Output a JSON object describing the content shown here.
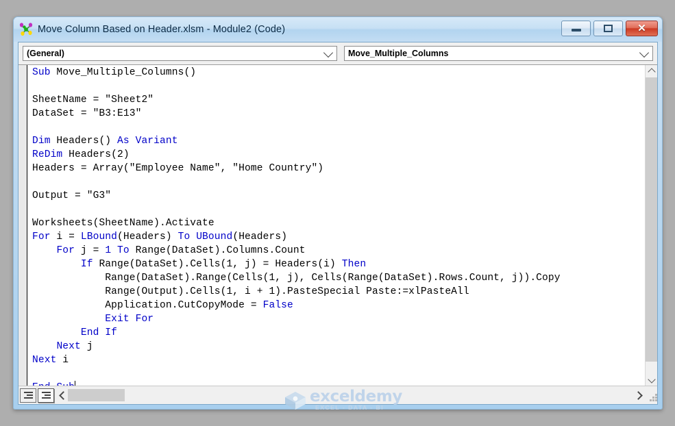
{
  "window": {
    "title": "Move Column Based on Header.xlsm - Module2 (Code)",
    "icon": "vba-module-icon",
    "buttons": {
      "minimize": "minimize-icon",
      "maximize": "maximize-icon",
      "close": "✕"
    }
  },
  "toolbar": {
    "object_combo": {
      "value": "(General)",
      "arrow": "chevron-down-icon"
    },
    "procedure_combo": {
      "value": "Move_Multiple_Columns",
      "arrow": "chevron-down-icon"
    }
  },
  "code": {
    "lines": [
      [
        {
          "t": "Sub",
          "k": true
        },
        {
          "t": " Move_Multiple_Columns()",
          "k": false
        }
      ],
      [],
      [
        {
          "t": "SheetName = \"Sheet2\"",
          "k": false
        }
      ],
      [
        {
          "t": "DataSet = \"B3:E13\"",
          "k": false
        }
      ],
      [],
      [
        {
          "t": "Dim",
          "k": true
        },
        {
          "t": " Headers() ",
          "k": false
        },
        {
          "t": "As Variant",
          "k": true
        }
      ],
      [
        {
          "t": "ReDim",
          "k": true
        },
        {
          "t": " Headers(2)",
          "k": false
        }
      ],
      [
        {
          "t": "Headers = Array(\"Employee Name\", \"Home Country\")",
          "k": false
        }
      ],
      [],
      [
        {
          "t": "Output = \"G3\"",
          "k": false
        }
      ],
      [],
      [
        {
          "t": "Worksheets(SheetName).Activate",
          "k": false
        }
      ],
      [
        {
          "t": "For",
          "k": true
        },
        {
          "t": " i = ",
          "k": false
        },
        {
          "t": "LBound",
          "k": true
        },
        {
          "t": "(Headers) ",
          "k": false
        },
        {
          "t": "To",
          "k": true
        },
        {
          "t": " ",
          "k": false
        },
        {
          "t": "UBound",
          "k": true
        },
        {
          "t": "(Headers)",
          "k": false
        }
      ],
      [
        {
          "t": "    ",
          "k": false
        },
        {
          "t": "For",
          "k": true
        },
        {
          "t": " j = ",
          "k": false
        },
        {
          "t": "1",
          "k": true
        },
        {
          "t": " ",
          "k": false
        },
        {
          "t": "To",
          "k": true
        },
        {
          "t": " Range(DataSet).Columns.Count",
          "k": false
        }
      ],
      [
        {
          "t": "        ",
          "k": false
        },
        {
          "t": "If",
          "k": true
        },
        {
          "t": " Range(DataSet).Cells(1, j) = Headers(i) ",
          "k": false
        },
        {
          "t": "Then",
          "k": true
        }
      ],
      [
        {
          "t": "            Range(DataSet).Range(Cells(1, j), Cells(Range(DataSet).Rows.Count, j)).Copy",
          "k": false
        }
      ],
      [
        {
          "t": "            Range(Output).Cells(1, i + 1).PasteSpecial Paste:=xlPasteAll",
          "k": false
        }
      ],
      [
        {
          "t": "            Application.CutCopyMode = ",
          "k": false
        },
        {
          "t": "False",
          "k": true
        }
      ],
      [
        {
          "t": "            ",
          "k": false
        },
        {
          "t": "Exit For",
          "k": true
        }
      ],
      [
        {
          "t": "        ",
          "k": false
        },
        {
          "t": "End If",
          "k": true
        }
      ],
      [
        {
          "t": "    ",
          "k": false
        },
        {
          "t": "Next",
          "k": true
        },
        {
          "t": " j",
          "k": false
        }
      ],
      [
        {
          "t": "Next",
          "k": true
        },
        {
          "t": " i",
          "k": false
        }
      ],
      [],
      [
        {
          "t": "End Sub",
          "k": true
        },
        {
          "t": "|CURSOR|",
          "k": false
        }
      ]
    ],
    "keyword_color": "#0000C8",
    "text_color": "#000000"
  },
  "bottom_bar": {
    "procedure_view_button": "procedure-view-icon",
    "full_module_view_button": "full-module-view-icon",
    "scroll_left": "chevron-left-icon",
    "scroll_right": "chevron-right-icon",
    "resize_grip": "resize-grip-icon"
  },
  "watermark": {
    "brand": "exceldemy",
    "tagline": "EXCEL - DATA - BI"
  }
}
